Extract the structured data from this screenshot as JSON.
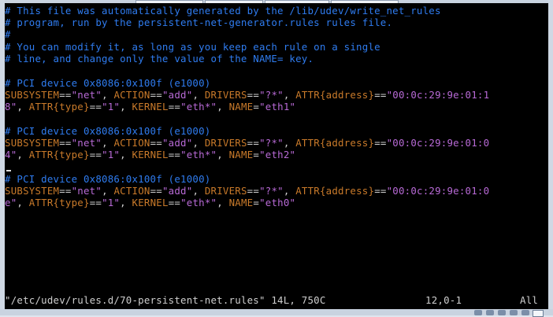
{
  "terminal": {
    "comments": [
      "# This file was automatically generated by the /lib/udev/write_net_rules",
      "# program, run by the persistent-net-generator.rules rules file.",
      "#",
      "# You can modify it, as long as you keep each rule on a single",
      "# line, and change only the value of the NAME= key."
    ],
    "blocks": [
      {
        "header": "# PCI device 0x8086:0x100f (e1000)",
        "subsystem_key": "SUBSYSTEM",
        "subsystem_val": "\"net\"",
        "action_key": "ACTION",
        "action_val": "\"add\"",
        "drivers_key": "DRIVERS",
        "drivers_val": "\"?*\"",
        "attr_addr_key": "ATTR{address}",
        "addr_part1": "\"00:0c:29:9e:01:1",
        "addr_part2": "8\"",
        "attr_type_key": "ATTR{type}",
        "type_val": "\"1\"",
        "kernel_key": "KERNEL",
        "kernel_val": "\"eth*\"",
        "name_key": "NAME",
        "name_val": "\"eth1\""
      },
      {
        "header": "# PCI device 0x8086:0x100f (e1000)",
        "subsystem_key": "SUBSYSTEM",
        "subsystem_val": "\"net\"",
        "action_key": "ACTION",
        "action_val": "\"add\"",
        "drivers_key": "DRIVERS",
        "drivers_val": "\"?*\"",
        "attr_addr_key": "ATTR{address}",
        "addr_part1": "\"00:0c:29:9e:01:0",
        "addr_part2": "4\"",
        "attr_type_key": "ATTR{type}",
        "type_val": "\"1\"",
        "kernel_key": "KERNEL",
        "kernel_val": "\"eth*\"",
        "name_key": "NAME",
        "name_val": "\"eth2\""
      },
      {
        "header": "# PCI device 0x8086:0x100f (e1000)",
        "subsystem_key": "SUBSYSTEM",
        "subsystem_val": "\"net\"",
        "action_key": "ACTION",
        "action_val": "\"add\"",
        "drivers_key": "DRIVERS",
        "drivers_val": "\"?*\"",
        "attr_addr_key": "ATTR{address}",
        "addr_part1": "\"00:0c:29:9e:01:0",
        "addr_part2": "e\"",
        "attr_type_key": "ATTR{type}",
        "type_val": "\"1\"",
        "kernel_key": "KERNEL",
        "kernel_val": "\"eth*\"",
        "name_key": "NAME",
        "name_val": "\"eth0\""
      }
    ],
    "status": {
      "file_info": "\"/etc/udev/rules.d/70-persistent-net.rules\" 14L, 750C",
      "position": "12,0-1",
      "scroll": "All"
    }
  },
  "colors": {
    "comment": "#2f7cf0",
    "keyword": "#c97a2a",
    "value": "#b86ad6",
    "background": "#000000"
  }
}
